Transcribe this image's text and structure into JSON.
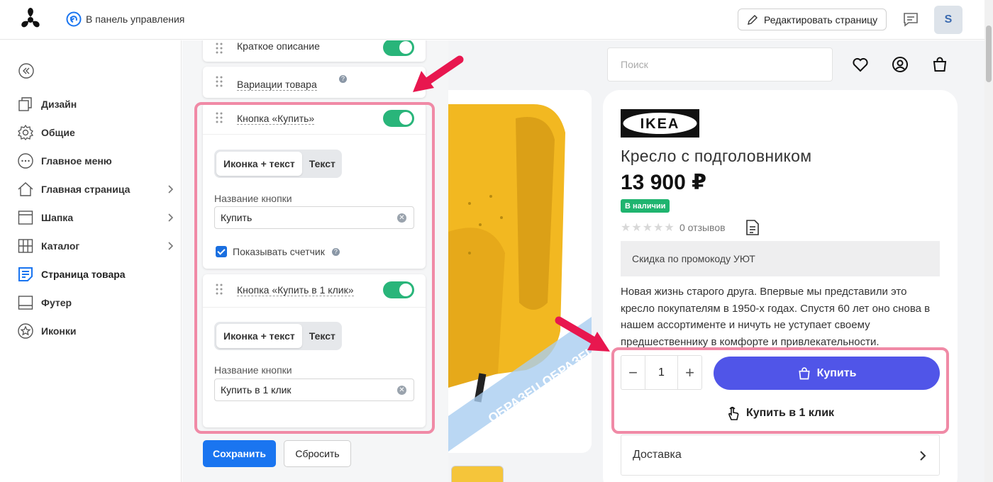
{
  "topbar": {
    "back_label": "В панель управления",
    "edit_label": "Редактировать страницу",
    "avatar_letter": "S"
  },
  "sidebar": {
    "items": [
      {
        "label": "Дизайн",
        "icon": "design-icon",
        "has_chevron": false
      },
      {
        "label": "Общие",
        "icon": "gear-icon",
        "has_chevron": false
      },
      {
        "label": "Главное меню",
        "icon": "dots-circle-icon",
        "has_chevron": false
      },
      {
        "label": "Главная страница",
        "icon": "home-icon",
        "has_chevron": true
      },
      {
        "label": "Шапка",
        "icon": "header-layout-icon",
        "has_chevron": true
      },
      {
        "label": "Каталог",
        "icon": "grid-icon",
        "has_chevron": true
      },
      {
        "label": "Страница товара",
        "icon": "product-page-icon",
        "has_chevron": false,
        "active": true
      },
      {
        "label": "Футер",
        "icon": "footer-layout-icon",
        "has_chevron": false
      },
      {
        "label": "Иконки",
        "icon": "star-circle-icon",
        "has_chevron": false
      }
    ]
  },
  "panel": {
    "short_desc": "Краткое описание",
    "variations": "Вариации товара",
    "buy_block": {
      "title": "Кнопка «Купить»",
      "seg_options": [
        "Иконка + текст",
        "Текст"
      ],
      "field_label": "Название кнопки",
      "field_value": "Купить",
      "checkbox_label": "Показывать счетчик"
    },
    "oneclick_block": {
      "title": "Кнопка «Купить в 1 клик»",
      "seg_options": [
        "Иконка + текст",
        "Текст"
      ],
      "field_label": "Название кнопки",
      "field_value": "Купить в 1 клик"
    },
    "save_label": "Сохранить",
    "reset_label": "Сбросить"
  },
  "preview": {
    "search_placeholder": "Поиск",
    "brand": "IKEA",
    "product_title": "Кресло с подголовником",
    "price": "13 900 ₽",
    "stock": "В наличии",
    "rating": 0,
    "reviews": "0 отзывов",
    "promo": "Скидка по промокоду УЮТ",
    "description": "Новая жизнь старого друга. Впервые мы представили это кресло покупателям в 1950-х годах. Спустя 60 лет оно снова в нашем ассортименте и ничуть не уступает своему предшественнику в комфорте и привлекательности.",
    "qty": "1",
    "buy_label": "Купить",
    "oneclick_label": "Купить в 1 клик",
    "delivery": "Доставка",
    "watermark": "ОБРАЗЕЦ  ОБРАЗЕЦ"
  },
  "colors": {
    "primary": "#1a75f0",
    "buy_button": "#5055e8",
    "toggle_on": "#29b57a",
    "stock_badge": "#1fb46f",
    "highlight": "#f08aa6",
    "arrow": "#e8174f"
  }
}
